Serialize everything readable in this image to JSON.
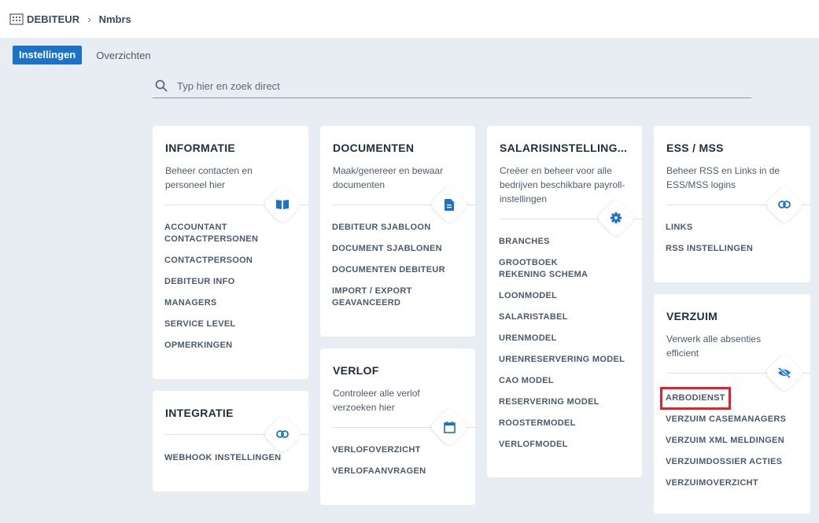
{
  "breadcrumb": {
    "root": "DEBITEUR",
    "current": "Nmbrs"
  },
  "tabs": [
    {
      "label": "Instellingen"
    },
    {
      "label": "Overzichten"
    }
  ],
  "search": {
    "placeholder": "Typ hier en zoek direct"
  },
  "cards": {
    "informatie": {
      "title": "INFORMATIE",
      "description": "Beheer contacten en personeel hier",
      "icon": "book-icon",
      "links": [
        "ACCOUNTANT CONTACTPERSONEN",
        "CONTACTPERSOON",
        "DEBITEUR INFO",
        "MANAGERS",
        "SERVICE LEVEL",
        "OPMERKINGEN"
      ]
    },
    "integratie": {
      "title": "INTEGRATIE",
      "icon": "link-icon",
      "links": [
        "WEBHOOK INSTELLINGEN"
      ]
    },
    "documenten": {
      "title": "DOCUMENTEN",
      "description": "Maak/genereer en bewaar documenten",
      "icon": "document-icon",
      "links": [
        "DEBITEUR SJABLOON",
        "DOCUMENT SJABLONEN",
        "DOCUMENTEN DEBITEUR",
        "IMPORT / EXPORT GEAVANCEERD"
      ]
    },
    "verlof": {
      "title": "VERLOF",
      "description": "Controleer alle verlof verzoeken hier",
      "icon": "calendar-icon",
      "links": [
        "VERLOFOVERZICHT",
        "VERLOFAANVRAGEN"
      ]
    },
    "salaris": {
      "title": "SALARISINSTELLING...",
      "description": "Creëer en beheer voor alle bedrijven beschikbare payroll-instellingen",
      "icon": "gear-icon",
      "links": [
        "BRANCHES",
        "GROOTBOEK REKENING SCHEMA",
        "LOONMODEL",
        "SALARISTABEL",
        "URENMODEL",
        "URENRESERVERING MODEL",
        "CAO MODEL",
        "RESERVERING MODEL",
        "ROOSTERMODEL",
        "VERLOFMODEL"
      ]
    },
    "ess": {
      "title": "ESS / MSS",
      "description": "Beheer RSS en Links in de ESS/MSS logins",
      "icon": "link-icon",
      "links": [
        "LINKS",
        "RSS INSTELLINGEN"
      ]
    },
    "verzuim": {
      "title": "VERZUIM",
      "description": "Verwerk alle absenties efficient",
      "icon": "eye-slash-icon",
      "links": [
        "ARBODIENST",
        "VERZUIM CASEMANAGERS",
        "VERZUIM XML MELDINGEN",
        "VERZUIMDOSSIER ACTIES",
        "VERZUIMOVERZICHT"
      ]
    }
  },
  "colors": {
    "accent": "#1a73c9",
    "highlight": "#e0232b",
    "background": "#e8edf4"
  }
}
